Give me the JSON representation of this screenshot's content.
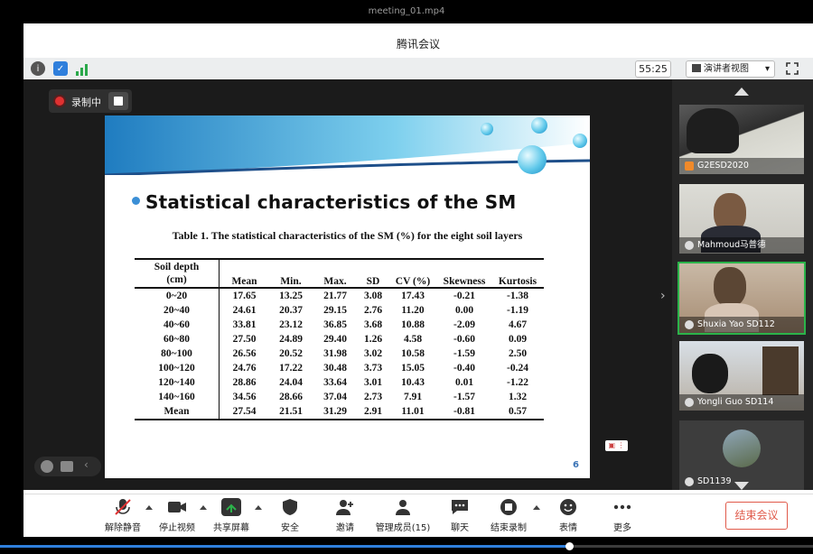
{
  "player": {
    "file_title": "meeting_01.mp4",
    "progress_fraction": 0.7
  },
  "app": {
    "title": "腾讯会议"
  },
  "toolbar": {
    "timer": "55:25",
    "view_label": "演讲者视图",
    "view_caret": "▾"
  },
  "recording": {
    "label": "录制中"
  },
  "slide": {
    "heading": "Statistical characteristics of the SM",
    "caption": "Table 1. The statistical characteristics of the SM (%) for the eight soil layers",
    "page_number": "6",
    "table": {
      "header_col0_line1": "Soil depth",
      "header_col0_line2": "(cm)",
      "columns": [
        "Mean",
        "Min.",
        "Max.",
        "SD",
        "CV (%)",
        "Skewness",
        "Kurtosis"
      ],
      "rows": [
        [
          "0~20",
          "17.65",
          "13.25",
          "21.77",
          "3.08",
          "17.43",
          "-0.21",
          "-1.38"
        ],
        [
          "20~40",
          "24.61",
          "20.37",
          "29.15",
          "2.76",
          "11.20",
          "0.00",
          "-1.19"
        ],
        [
          "40~60",
          "33.81",
          "23.12",
          "36.85",
          "3.68",
          "10.88",
          "-2.09",
          "4.67"
        ],
        [
          "60~80",
          "27.50",
          "24.89",
          "29.40",
          "1.26",
          "4.58",
          "-0.60",
          "0.09"
        ],
        [
          "80~100",
          "26.56",
          "20.52",
          "31.98",
          "3.02",
          "10.58",
          "-1.59",
          "2.50"
        ],
        [
          "100~120",
          "24.76",
          "17.22",
          "30.48",
          "3.73",
          "15.05",
          "-0.40",
          "-0.24"
        ],
        [
          "120~140",
          "28.86",
          "24.04",
          "33.64",
          "3.01",
          "10.43",
          "0.01",
          "-1.22"
        ],
        [
          "140~160",
          "34.56",
          "28.66",
          "37.04",
          "2.73",
          "7.91",
          "-1.57",
          "1.32"
        ],
        [
          "Mean",
          "27.54",
          "21.51",
          "31.29",
          "2.91",
          "11.01",
          "-0.81",
          "0.57"
        ]
      ]
    }
  },
  "participants": [
    {
      "name": "G2ESD2020"
    },
    {
      "name": "Mahmoud马普德"
    },
    {
      "name": "Shuxia Yao SD112"
    },
    {
      "name": "Yongli Guo SD114"
    },
    {
      "name": "SD1139"
    }
  ],
  "bottom_bar": {
    "mute": "解除静音",
    "stop_video": "停止视频",
    "share_screen": "共享屏幕",
    "security": "安全",
    "invite": "邀请",
    "manage_members": "管理成员(15)",
    "chat": "聊天",
    "end_recording": "结束录制",
    "reactions": "表情",
    "more": "更多",
    "end_meeting": "结束会议"
  }
}
